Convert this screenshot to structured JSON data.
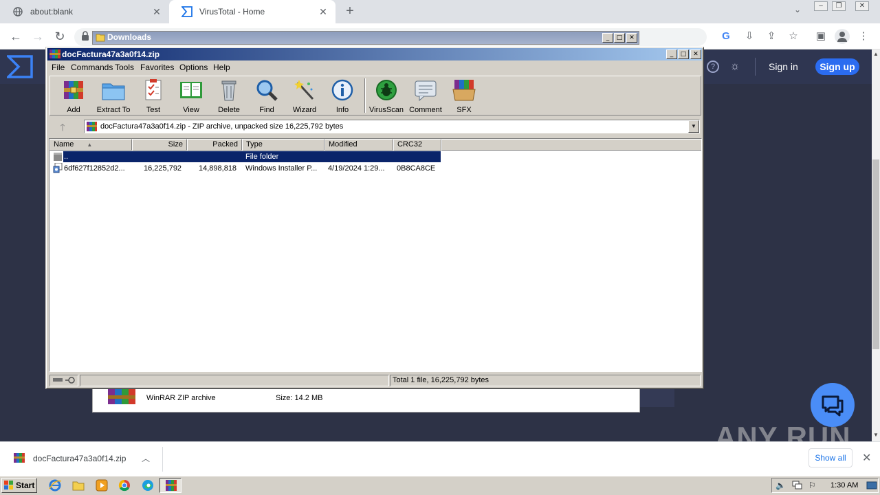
{
  "browser": {
    "tabs": [
      {
        "title": "about:blank"
      },
      {
        "title": "VirusTotal - Home"
      }
    ]
  },
  "virustotal": {
    "sign_in": "Sign in",
    "sign_up": "Sign up",
    "archive_type": "WinRAR ZIP archive",
    "archive_size": "Size: 14.2 MB",
    "help_glyph": "?",
    "watermark": "ANY RUN"
  },
  "downloads_window": {
    "title": "Downloads"
  },
  "winrar": {
    "title": "docFactura47a3a0f14.zip",
    "menu": [
      "File",
      "Commands",
      "Tools",
      "Favorites",
      "Options",
      "Help"
    ],
    "tools": [
      {
        "label": "Add",
        "icon": "add-archive-icon"
      },
      {
        "label": "Extract To",
        "icon": "extract-folder-icon"
      },
      {
        "label": "Test",
        "icon": "test-checklist-icon"
      },
      {
        "label": "View",
        "icon": "view-book-icon"
      },
      {
        "label": "Delete",
        "icon": "trash-icon"
      },
      {
        "label": "Find",
        "icon": "magnifier-icon"
      },
      {
        "label": "Wizard",
        "icon": "wand-icon"
      },
      {
        "label": "Info",
        "icon": "info-icon"
      },
      {
        "label": "VirusScan",
        "icon": "bug-icon"
      },
      {
        "label": "Comment",
        "icon": "comment-icon"
      },
      {
        "label": "SFX",
        "icon": "sfx-box-icon"
      }
    ],
    "path": "docFactura47a3a0f14.zip - ZIP archive, unpacked size 16,225,792 bytes",
    "columns": [
      "Name",
      "Size",
      "Packed",
      "Type",
      "Modified",
      "CRC32"
    ],
    "rows": [
      {
        "name": "..",
        "size": "",
        "packed": "",
        "type": "File folder",
        "modified": "",
        "crc": ""
      },
      {
        "name": "6df627f12852d2...",
        "size": "16,225,792",
        "packed": "14,898,818",
        "type": "Windows Installer P...",
        "modified": "4/19/2024 1:29...",
        "crc": "0B8CA8CE"
      }
    ],
    "status": "Total 1 file, 16,225,792 bytes"
  },
  "download_bar": {
    "file": "docFactura47a3a0f14.zip",
    "show_all": "Show all"
  },
  "taskbar": {
    "start": "Start",
    "clock": "1:30 AM"
  },
  "colors": {
    "vt_bg": "#2d3246",
    "vt_accent": "#2b6cf0",
    "winrar_title": "#0a246a",
    "selection": "#0a246a"
  }
}
